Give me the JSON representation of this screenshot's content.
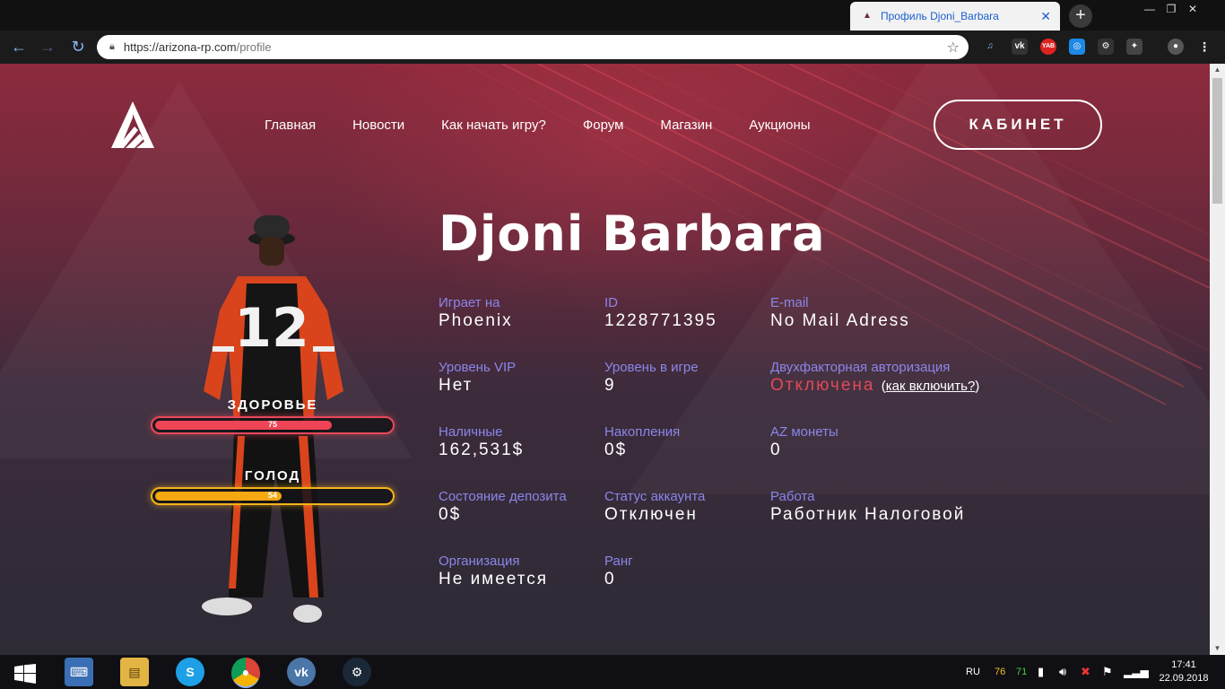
{
  "browser": {
    "tab_title": "Профиль Djoni_Barbara",
    "tab_close": "✕",
    "new_tab": "+",
    "url_host": "https://arizona-rp.com",
    "url_path": "/profile"
  },
  "nav": {
    "items": [
      "Главная",
      "Новости",
      "Как начать игру?",
      "Форум",
      "Магазин",
      "Аукционы"
    ],
    "cabinet": "КАБИНЕТ"
  },
  "character": {
    "health_label": "ЗДОРОВЬЕ",
    "health_value": "75",
    "health_percent": 75,
    "hunger_label": "ГОЛОД",
    "hunger_value": "54",
    "hunger_percent": 54
  },
  "profile": {
    "name": "Djoni Barbara",
    "stats": {
      "server": {
        "label": "Играет на",
        "value": "Phoenix"
      },
      "id": {
        "label": "ID",
        "value": "1228771395"
      },
      "email": {
        "label": "E-mail",
        "value": "No Mail Adress"
      },
      "vip": {
        "label": "Уровень VIP",
        "value": "Нет"
      },
      "level": {
        "label": "Уровень в игре",
        "value": "9"
      },
      "twofa": {
        "label": "Двухфакторная авторизация",
        "value": "Отключена",
        "help_open": "(",
        "help_link": "как включить?",
        "help_close": ")"
      },
      "cash": {
        "label": "Наличные",
        "value": "162,531$"
      },
      "savings": {
        "label": "Накопления",
        "value": "0$"
      },
      "az": {
        "label": "AZ монеты",
        "value": "0"
      },
      "deposit": {
        "label": "Состояние депозита",
        "value": "0$"
      },
      "account": {
        "label": "Статус аккаунта",
        "value": "Отключен"
      },
      "job": {
        "label": "Работа",
        "value": "Работник Налоговой"
      },
      "org": {
        "label": "Организация",
        "value": "Не имеется"
      },
      "rank": {
        "label": "Ранг",
        "value": "0"
      }
    }
  },
  "taskbar": {
    "lang": "RU",
    "temp1": "76",
    "temp2": "71",
    "time": "17:41",
    "date": "22.09.2018"
  },
  "colors": {
    "label_purple": "#8b86e8",
    "danger_red": "#e24a58",
    "health": "#ee4455",
    "hunger": "#f5a811"
  }
}
